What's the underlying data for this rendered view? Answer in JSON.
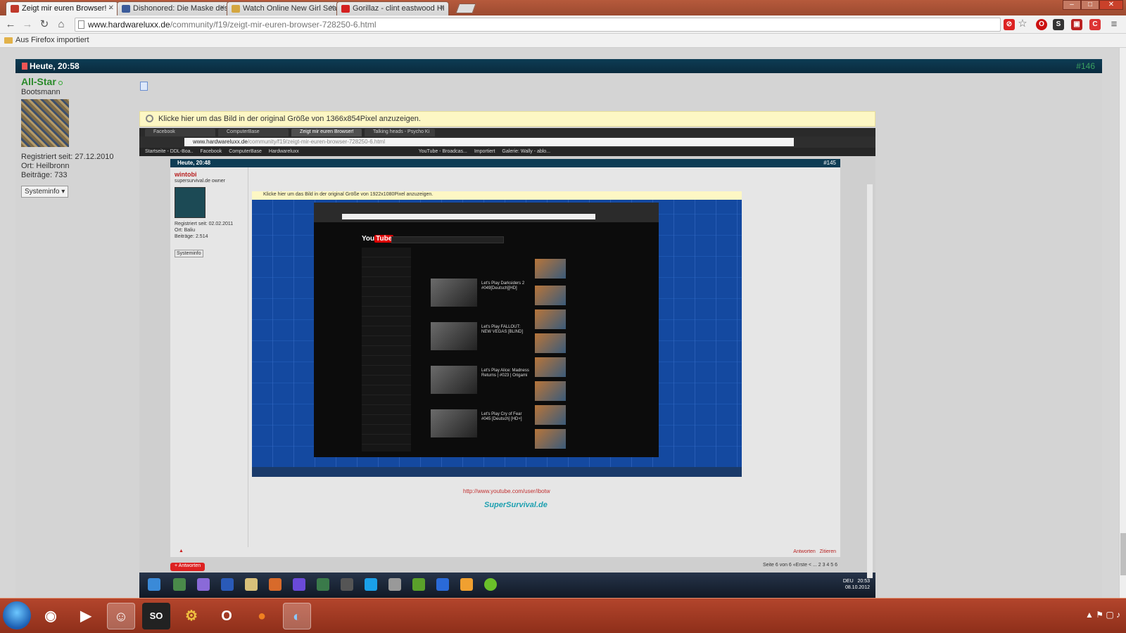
{
  "browser": {
    "tabs": [
      {
        "title": "Zeigt mir euren Browser! -",
        "active": true,
        "favicon_color": "#c0392b"
      },
      {
        "title": "Dishonored: Die Maske des",
        "active": false,
        "favicon_color": "#3b5b9a"
      },
      {
        "title": "Watch Online New Girl Sea",
        "active": false,
        "favicon_color": "#d4a640"
      },
      {
        "title": "Gorillaz - clint eastwood HI",
        "active": false,
        "favicon_color": "#d42020"
      }
    ],
    "url_domain": "www.hardwareluxx.de",
    "url_path": "/community/f19/zeigt-mir-euren-browser-728250-6.html",
    "bookmark_folder": "Aus Firefox importiert"
  },
  "post": {
    "header_time": "Heute, 20:58",
    "user": {
      "name": "All-Star",
      "rank": "Bootsmann",
      "registered": "Registriert seit: 27.12.2010",
      "location": "Ort: Heilbronn",
      "posts": "Beiträge: 733",
      "sysinfo_button": "Systeminfo"
    },
    "image_notice": "Klicke hier um das Bild in der original Größe von 1366x854Pixel anzuzeigen."
  },
  "embedded": {
    "tabs": [
      "Facebook",
      "ComputerBase",
      "Zeigt mir euren Browser!",
      "Talking heads - Psycho Ki"
    ],
    "url_domain": "www.hardwareluxx.de",
    "url_path": "/community/f19/zeigt-mir-euren-browser-728250-6.html",
    "bookmarks": [
      "Startseite - DDL-Boa..",
      "Facebook",
      "ComputerBase",
      "Hardwareluxx",
      "YouTube - Broadcas...",
      "Importiert",
      "Galerie: Wally - ablo..."
    ],
    "post_time": "Heute, 20:48",
    "post_number": "#145",
    "user": {
      "name": "wintobi",
      "title": "supersurvival.de owner",
      "registered": "Registriert seit: 02.02.2011",
      "location": "Ort: Baliu",
      "posts": "Beiträge: 2.514",
      "sysinfo_button": "Systeminfo"
    },
    "image_notice": "Klicke hier um das Bild in der original Größe von 1922x1080Pixel anzuzeigen.",
    "youtube": {
      "logo": "You",
      "logo_tube": "Tube",
      "videos": [
        "Let's Play Darksiders 2 #049[Deutsch][HD]",
        "Let's Play FALLOUT: NEW VEGAS [BLIND]",
        "Let's Play Alice: Madness Returns | #023 | Origami",
        "Let's Play Cry of Fear #045 [Deutsch] [HD+]"
      ]
    },
    "link": "http://www.youtube.com/user/ibotw",
    "logo_text": "SuperSurvival.de",
    "reply_label": "Antworten",
    "quote_label": "Zitieren",
    "answer_button": "+ Antworten",
    "pager": "Seite 6 von 6   «Erste   <   ...   2   3   4   5   6",
    "clock_time": "20:53",
    "clock_date": "08.10.2012",
    "lang": "DEU"
  },
  "taskbar": {
    "apps": [
      "start",
      "webcam-eye",
      "media-player",
      "chat-app",
      "so-app",
      "tool-app",
      "opera",
      "firefox",
      "browser-active"
    ]
  }
}
